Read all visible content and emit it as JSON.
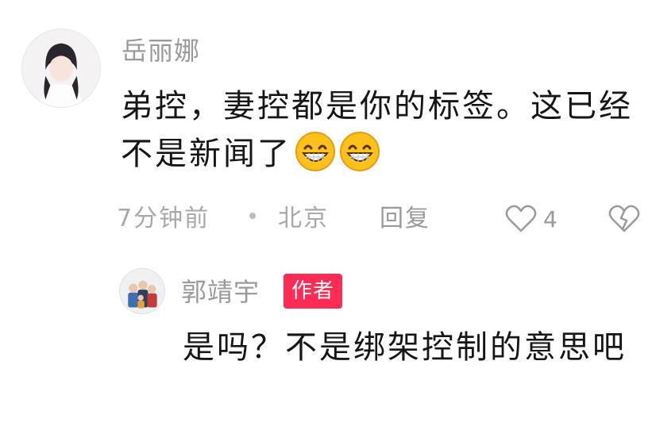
{
  "comment": {
    "username": "岳丽娜",
    "text": "弟控，妻控都是你的标签。这已经不是新闻了",
    "emojis": [
      "grinning-face",
      "grinning-face"
    ],
    "time": "7分钟前",
    "location": "北京",
    "reply_label": "回复",
    "like_count": "4"
  },
  "reply": {
    "username": "郭靖宇",
    "badge": "作者",
    "text": "是吗？不是绑架控制的意思吧"
  },
  "colors": {
    "badge": "#fe2c55",
    "meta_text": "#a8a8a8",
    "body_text": "#161616"
  },
  "icons": {
    "like": "heart-outline-icon",
    "dislike": "broken-heart-icon",
    "emoji": "grinning-face-emoji"
  }
}
